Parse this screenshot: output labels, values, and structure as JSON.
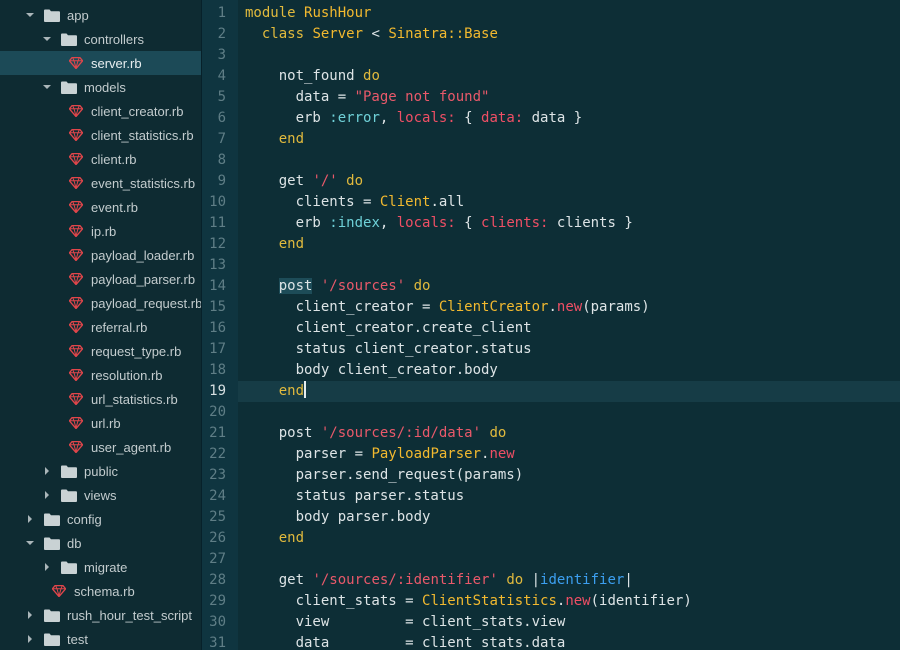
{
  "sidebar": {
    "rows": [
      {
        "label": "app",
        "type": "folder",
        "depth": 0,
        "expanded": true,
        "selected": false
      },
      {
        "label": "controllers",
        "type": "folder",
        "depth": 1,
        "expanded": true,
        "selected": false
      },
      {
        "label": "server.rb",
        "type": "ruby-file",
        "depth": 2,
        "selected": true
      },
      {
        "label": "models",
        "type": "folder",
        "depth": 1,
        "expanded": true,
        "selected": false
      },
      {
        "label": "client_creator.rb",
        "type": "ruby-file",
        "depth": 2,
        "selected": false
      },
      {
        "label": "client_statistics.rb",
        "type": "ruby-file",
        "depth": 2,
        "selected": false
      },
      {
        "label": "client.rb",
        "type": "ruby-file",
        "depth": 2,
        "selected": false
      },
      {
        "label": "event_statistics.rb",
        "type": "ruby-file",
        "depth": 2,
        "selected": false
      },
      {
        "label": "event.rb",
        "type": "ruby-file",
        "depth": 2,
        "selected": false
      },
      {
        "label": "ip.rb",
        "type": "ruby-file",
        "depth": 2,
        "selected": false
      },
      {
        "label": "payload_loader.rb",
        "type": "ruby-file",
        "depth": 2,
        "selected": false
      },
      {
        "label": "payload_parser.rb",
        "type": "ruby-file",
        "depth": 2,
        "selected": false
      },
      {
        "label": "payload_request.rb",
        "type": "ruby-file",
        "depth": 2,
        "selected": false
      },
      {
        "label": "referral.rb",
        "type": "ruby-file",
        "depth": 2,
        "selected": false
      },
      {
        "label": "request_type.rb",
        "type": "ruby-file",
        "depth": 2,
        "selected": false
      },
      {
        "label": "resolution.rb",
        "type": "ruby-file",
        "depth": 2,
        "selected": false
      },
      {
        "label": "url_statistics.rb",
        "type": "ruby-file",
        "depth": 2,
        "selected": false
      },
      {
        "label": "url.rb",
        "type": "ruby-file",
        "depth": 2,
        "selected": false
      },
      {
        "label": "user_agent.rb",
        "type": "ruby-file",
        "depth": 2,
        "selected": false
      },
      {
        "label": "public",
        "type": "folder",
        "depth": 1,
        "expanded": false,
        "selected": false
      },
      {
        "label": "views",
        "type": "folder",
        "depth": 1,
        "expanded": false,
        "selected": false
      },
      {
        "label": "config",
        "type": "folder",
        "depth": 0,
        "expanded": false,
        "selected": false
      },
      {
        "label": "db",
        "type": "folder",
        "depth": 0,
        "expanded": true,
        "selected": false
      },
      {
        "label": "migrate",
        "type": "folder",
        "depth": 1,
        "expanded": false,
        "selected": false
      },
      {
        "label": "schema.rb",
        "type": "ruby-file",
        "depth": 1,
        "selected": false
      },
      {
        "label": "rush_hour_test_script",
        "type": "folder",
        "depth": 0,
        "expanded": false,
        "selected": false
      },
      {
        "label": "test",
        "type": "folder",
        "depth": 0,
        "expanded": false,
        "selected": false
      }
    ]
  },
  "editor": {
    "current_line": 19,
    "lines": [
      {
        "n": "1",
        "tokens": [
          {
            "t": "module ",
            "c": "kw"
          },
          {
            "t": "RushHour",
            "c": "const"
          }
        ]
      },
      {
        "n": "2",
        "tokens": [
          {
            "t": "  class ",
            "c": "kw"
          },
          {
            "t": "Server",
            "c": "const"
          },
          {
            "t": " < ",
            "c": "plain"
          },
          {
            "t": "Sinatra::Base",
            "c": "const"
          }
        ]
      },
      {
        "n": "3",
        "tokens": []
      },
      {
        "n": "4",
        "tokens": [
          {
            "t": "    not_found ",
            "c": "plain"
          },
          {
            "t": "do",
            "c": "kw"
          }
        ]
      },
      {
        "n": "5",
        "tokens": [
          {
            "t": "      data = ",
            "c": "plain"
          },
          {
            "t": "\"Page not found\"",
            "c": "str"
          }
        ]
      },
      {
        "n": "6",
        "tokens": [
          {
            "t": "      erb ",
            "c": "plain"
          },
          {
            "t": ":error",
            "c": "sym"
          },
          {
            "t": ", ",
            "c": "plain"
          },
          {
            "t": "locals:",
            "c": "sym-red"
          },
          {
            "t": " { ",
            "c": "plain"
          },
          {
            "t": "data:",
            "c": "sym-red"
          },
          {
            "t": " data }",
            "c": "plain"
          }
        ]
      },
      {
        "n": "7",
        "tokens": [
          {
            "t": "    end",
            "c": "kw"
          }
        ]
      },
      {
        "n": "8",
        "tokens": []
      },
      {
        "n": "9",
        "tokens": [
          {
            "t": "    get ",
            "c": "plain"
          },
          {
            "t": "'/'",
            "c": "str"
          },
          {
            "t": " ",
            "c": "plain"
          },
          {
            "t": "do",
            "c": "kw"
          }
        ]
      },
      {
        "n": "10",
        "tokens": [
          {
            "t": "      clients = ",
            "c": "plain"
          },
          {
            "t": "Client",
            "c": "const"
          },
          {
            "t": ".all",
            "c": "plain"
          }
        ]
      },
      {
        "n": "11",
        "tokens": [
          {
            "t": "      erb ",
            "c": "plain"
          },
          {
            "t": ":index",
            "c": "sym"
          },
          {
            "t": ", ",
            "c": "plain"
          },
          {
            "t": "locals:",
            "c": "sym-red"
          },
          {
            "t": " { ",
            "c": "plain"
          },
          {
            "t": "clients:",
            "c": "sym-red"
          },
          {
            "t": " clients }",
            "c": "plain"
          }
        ]
      },
      {
        "n": "12",
        "tokens": [
          {
            "t": "    end",
            "c": "kw"
          }
        ]
      },
      {
        "n": "13",
        "tokens": []
      },
      {
        "n": "14",
        "tokens": [
          {
            "t": "    ",
            "c": "plain"
          },
          {
            "t": "post",
            "c": "plain",
            "hl": true
          },
          {
            "t": " ",
            "c": "plain"
          },
          {
            "t": "'/sources'",
            "c": "str"
          },
          {
            "t": " ",
            "c": "plain"
          },
          {
            "t": "do",
            "c": "kw"
          }
        ]
      },
      {
        "n": "15",
        "tokens": [
          {
            "t": "      client_creator = ",
            "c": "plain"
          },
          {
            "t": "ClientCreator",
            "c": "const"
          },
          {
            "t": ".",
            "c": "plain"
          },
          {
            "t": "new",
            "c": "sym-red"
          },
          {
            "t": "(params)",
            "c": "plain"
          }
        ]
      },
      {
        "n": "16",
        "tokens": [
          {
            "t": "      client_creator.create_client",
            "c": "plain"
          }
        ]
      },
      {
        "n": "17",
        "tokens": [
          {
            "t": "      status client_creator.status",
            "c": "plain"
          }
        ]
      },
      {
        "n": "18",
        "tokens": [
          {
            "t": "      body client_creator.body",
            "c": "plain"
          }
        ]
      },
      {
        "n": "19",
        "tokens": [
          {
            "t": "    end",
            "c": "kw",
            "caret": true
          }
        ]
      },
      {
        "n": "20",
        "tokens": []
      },
      {
        "n": "21",
        "tokens": [
          {
            "t": "    post ",
            "c": "plain"
          },
          {
            "t": "'/sources/:id/data'",
            "c": "str"
          },
          {
            "t": " ",
            "c": "plain"
          },
          {
            "t": "do",
            "c": "kw"
          }
        ]
      },
      {
        "n": "22",
        "tokens": [
          {
            "t": "      parser = ",
            "c": "plain"
          },
          {
            "t": "PayloadParser",
            "c": "const"
          },
          {
            "t": ".",
            "c": "plain"
          },
          {
            "t": "new",
            "c": "sym-red"
          }
        ]
      },
      {
        "n": "23",
        "tokens": [
          {
            "t": "      parser.send_request(params)",
            "c": "plain"
          }
        ]
      },
      {
        "n": "24",
        "tokens": [
          {
            "t": "      status parser.status",
            "c": "plain"
          }
        ]
      },
      {
        "n": "25",
        "tokens": [
          {
            "t": "      body parser.body",
            "c": "plain"
          }
        ]
      },
      {
        "n": "26",
        "tokens": [
          {
            "t": "    end",
            "c": "kw"
          }
        ]
      },
      {
        "n": "27",
        "tokens": []
      },
      {
        "n": "28",
        "tokens": [
          {
            "t": "    get ",
            "c": "plain"
          },
          {
            "t": "'/sources/:identifier'",
            "c": "str"
          },
          {
            "t": " ",
            "c": "plain"
          },
          {
            "t": "do",
            "c": "kw"
          },
          {
            "t": " |",
            "c": "plain"
          },
          {
            "t": "identifier",
            "c": "blk"
          },
          {
            "t": "|",
            "c": "plain"
          }
        ]
      },
      {
        "n": "29",
        "tokens": [
          {
            "t": "      client_stats = ",
            "c": "plain"
          },
          {
            "t": "ClientStatistics",
            "c": "const"
          },
          {
            "t": ".",
            "c": "plain"
          },
          {
            "t": "new",
            "c": "sym-red"
          },
          {
            "t": "(identifier)",
            "c": "plain"
          }
        ]
      },
      {
        "n": "30",
        "tokens": [
          {
            "t": "      view         = client_stats.view",
            "c": "plain"
          }
        ]
      },
      {
        "n": "31",
        "tokens": [
          {
            "t": "      data         = client_stats.data",
            "c": "plain"
          }
        ]
      }
    ]
  },
  "colors": {
    "keyword": "#e1ba3d",
    "string": "#e9596a",
    "symbol": "#6fd1d8",
    "constant": "#f2b92f",
    "ruby_icon": "#e0464b",
    "folder_icon": "#c9d2d4"
  }
}
